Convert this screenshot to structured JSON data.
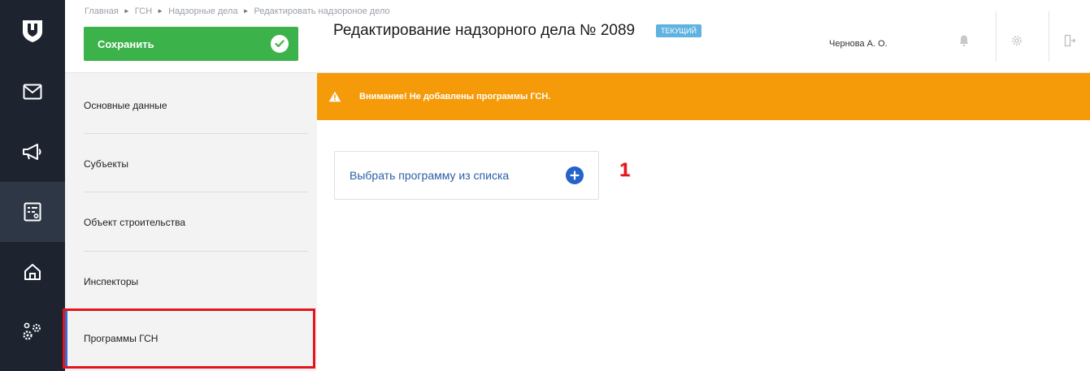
{
  "breadcrumb": [
    "Главная",
    "ГСН",
    "Надзорные дела",
    "Редактировать надзороное дело"
  ],
  "breadcrumb_sep": "►",
  "toolbar": {
    "save_label": "Сохранить"
  },
  "header": {
    "title": "Редактирование надзорного дела № 2089",
    "status_badge": "ТЕКУЩИЙ",
    "user_name": "Чернова А. О."
  },
  "rail": {
    "icons": [
      "logo-shield-icon",
      "mail-icon",
      "megaphone-icon",
      "form-list-icon",
      "home-icon",
      "gears-icon"
    ],
    "active_index": 3
  },
  "section_nav": {
    "items": [
      {
        "label": "Основные данные"
      },
      {
        "label": "Субъекты"
      },
      {
        "label": "Объект строительства"
      },
      {
        "label": "Инспекторы"
      },
      {
        "label": "Программы ГСН"
      }
    ],
    "active_index": 4
  },
  "warning": {
    "text": "Внимание! Не добавлены программы ГСН."
  },
  "main": {
    "choose_button_label": "Выбрать программу из списка"
  },
  "annotation": {
    "step": "1"
  },
  "colors": {
    "rail": "#1d2430",
    "save": "#3cb34a",
    "warning": "#f59b0a",
    "accent": "#2563c8",
    "highlight": "#e3141b"
  }
}
